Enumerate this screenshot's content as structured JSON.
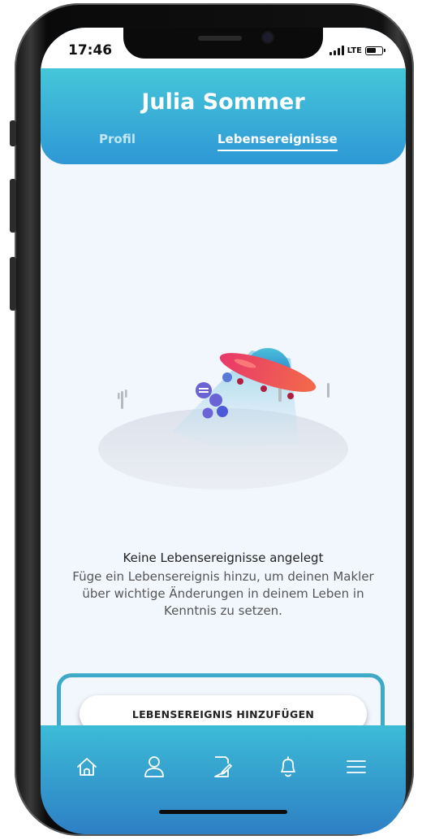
{
  "status_bar": {
    "time": "17:46",
    "network": "LTE"
  },
  "header": {
    "user_name": "Julia Sommer",
    "tabs": [
      {
        "label": "Profil",
        "active": false
      },
      {
        "label": "Lebensereignisse",
        "active": true
      }
    ]
  },
  "empty_state": {
    "title": "Keine Lebensereignisse angelegt",
    "description": "Füge ein Lebensereignis hinzu, um deinen Makler über wichtige Änderungen in deinem Leben in Kenntnis zu setzen."
  },
  "actions": {
    "add_event_label": "LEBENSEREIGNIS HINZUFÜGEN"
  },
  "tabbar": {
    "icons": [
      "home-icon",
      "profile-icon",
      "documents-icon",
      "notifications-icon",
      "menu-icon"
    ]
  },
  "colors": {
    "header_gradient_top": "#45c6d8",
    "header_gradient_bottom": "#2e98d6",
    "page_background": "#f2f6fd",
    "highlight_border": "#3fa9c9",
    "ufo_red": "#e8386a"
  }
}
